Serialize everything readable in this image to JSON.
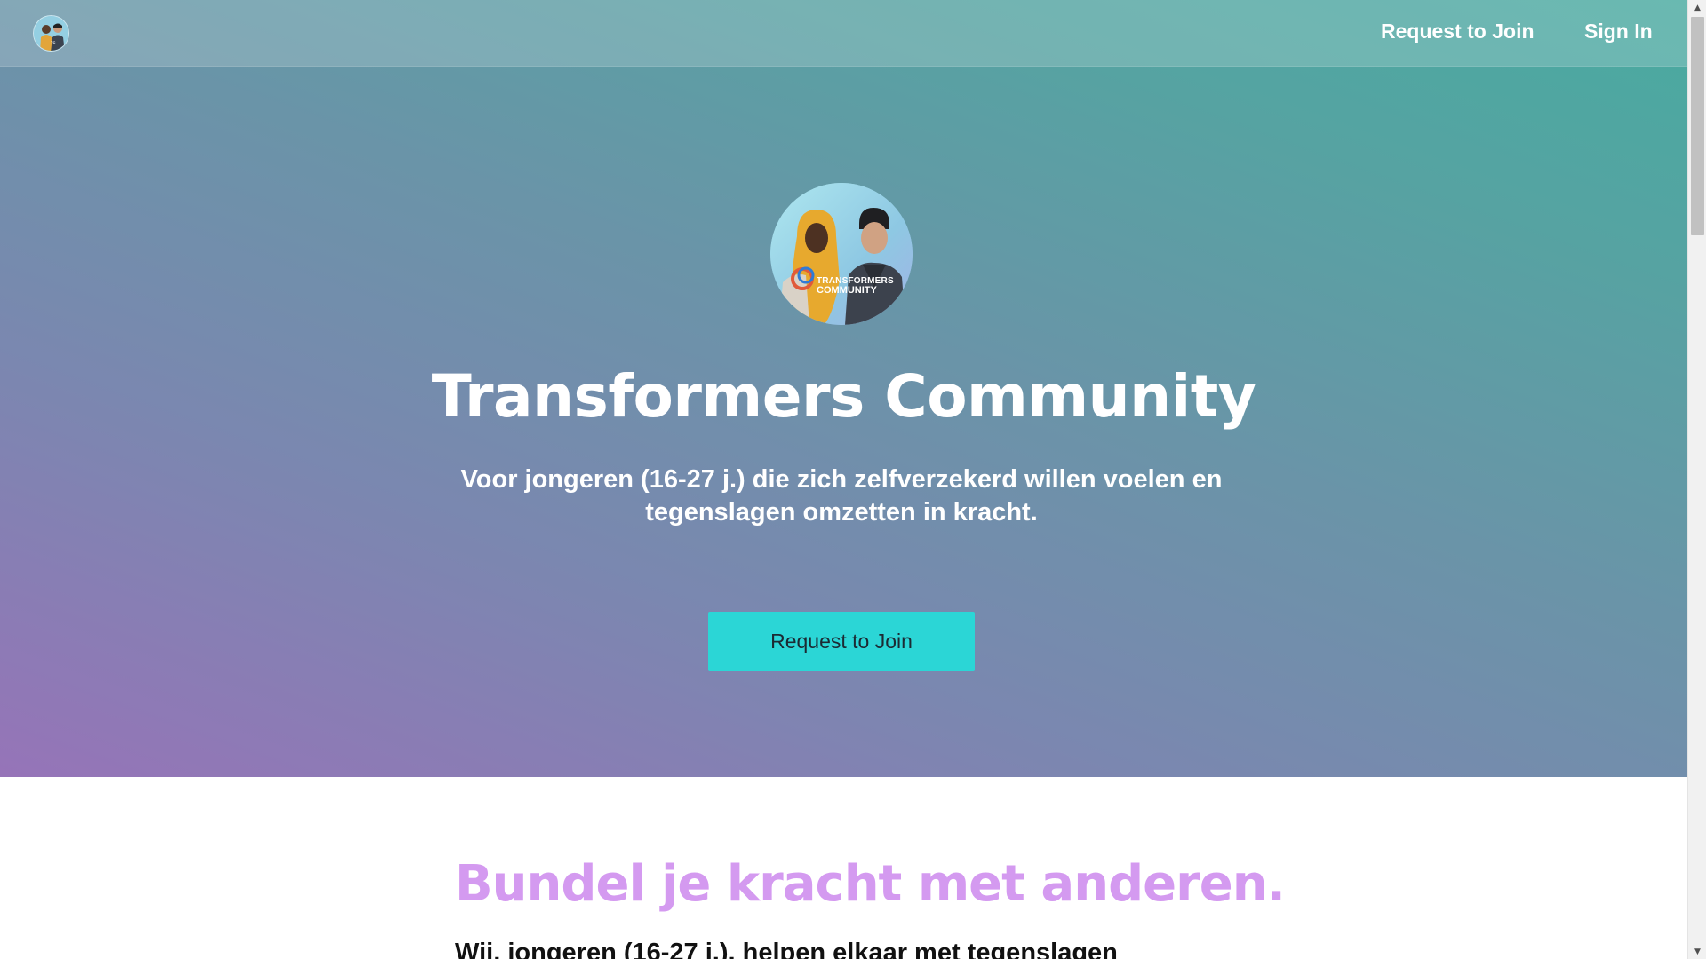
{
  "nav": {
    "logo_icon": "community-logo-icon",
    "request_to_join": "Request to Join",
    "sign_in": "Sign In"
  },
  "hero": {
    "avatar_icon": "community-avatar-icon",
    "avatar_brand_line1": "TRANSFORMERS",
    "avatar_brand_line2": "COMMUNITY",
    "title": "Transformers Community",
    "subtitle": "Voor jongeren (16-27 j.) die zich zelfverzekerd willen voelen en tegenslagen omzetten in kracht.",
    "cta_label": "Request to Join"
  },
  "section": {
    "heading": "Bundel je kracht met anderen.",
    "text": "Wij, jongeren (16-27 j.), helpen elkaar met tegenslagen"
  },
  "colors": {
    "cta": "#2bd6d6",
    "heading_accent": "#d49af0",
    "gradient_start": "#9674b8",
    "gradient_end": "#49aaa0"
  }
}
